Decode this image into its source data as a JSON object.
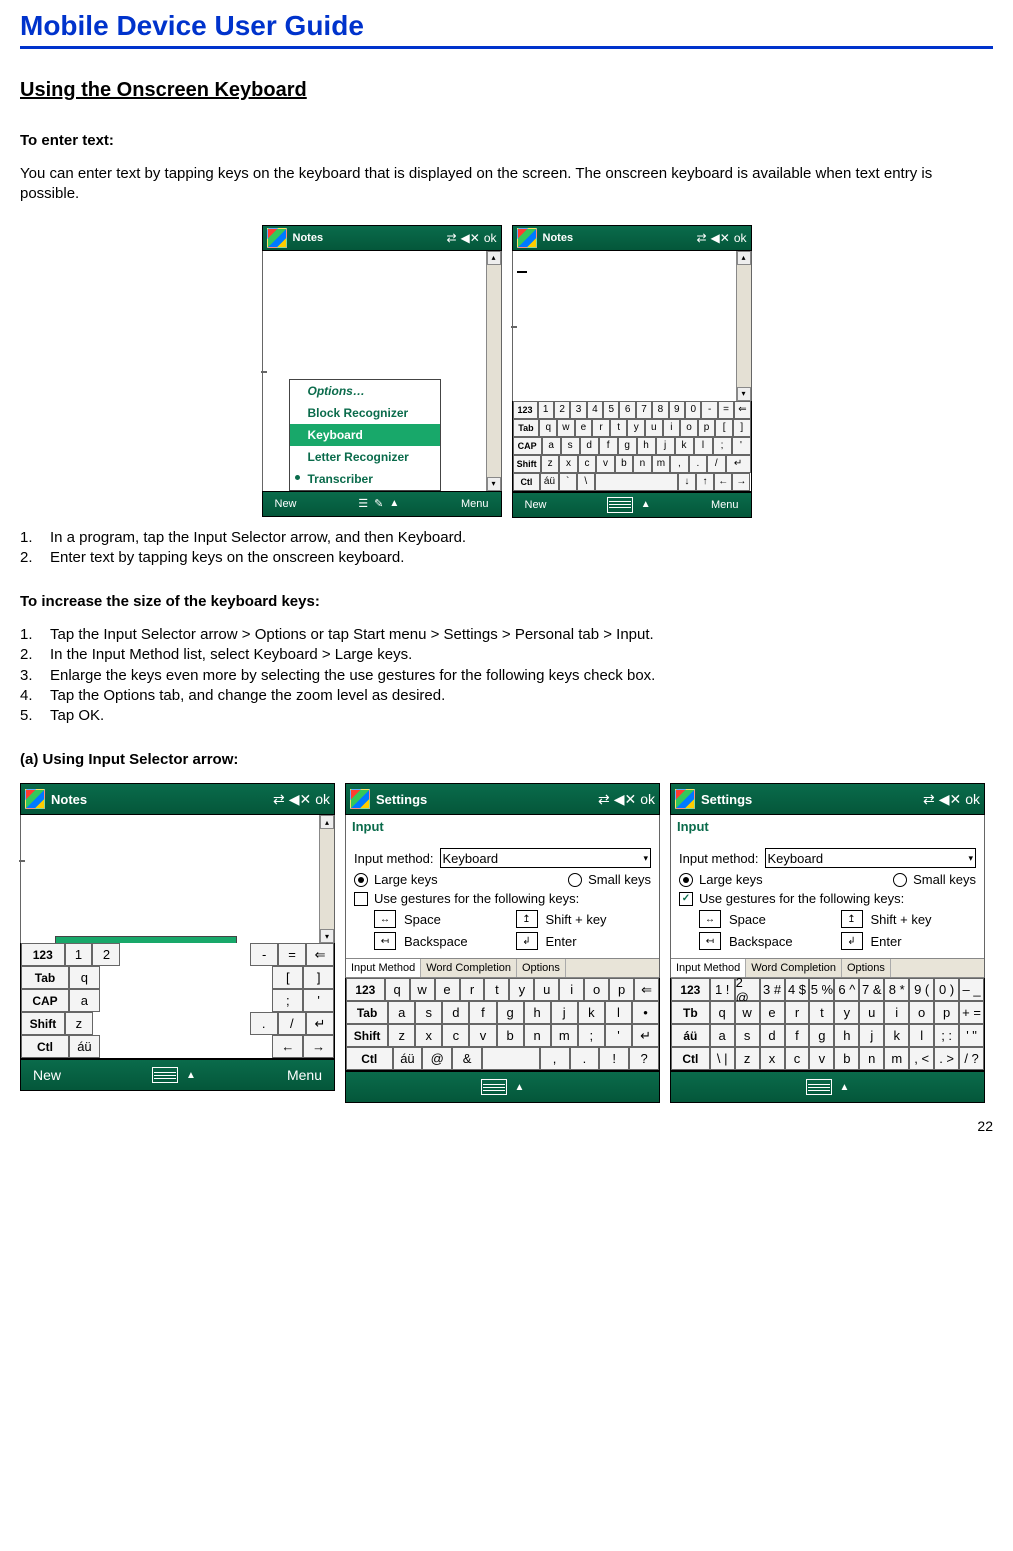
{
  "doc": {
    "title": "Mobile Device User Guide",
    "page_number": "22",
    "section_heading": "Using the Onscreen Keyboard",
    "enter_heading": "To enter text:",
    "enter_body": "You can enter text by tapping keys on the keyboard that is displayed on the screen. The onscreen keyboard is available when text entry is possible.",
    "enter_steps": [
      "In a program, tap the Input Selector arrow, and then Keyboard.",
      "Enter text by tapping keys on the onscreen keyboard."
    ],
    "enlarge_heading": "To increase the size of the keyboard keys:",
    "enlarge_steps": [
      "Tap the Input Selector arrow > Options or tap Start menu > Settings > Personal tab > Input.",
      "In the Input Method list, select Keyboard > Large keys.",
      "Enlarge the keys even more by selecting the use gestures for the following keys check box.",
      "Tap the Options tab, and change the zoom level as desired.",
      "Tap OK."
    ],
    "subsection_a": "(a)   Using Input Selector arrow:"
  },
  "common": {
    "ok": "ok",
    "new": "New",
    "menu": "Menu",
    "signal_glyph": "⇄",
    "volume_glyph": "◀✕"
  },
  "apps": {
    "notes": "Notes",
    "settings": "Settings",
    "input_section": "Input"
  },
  "im_popup": {
    "options": "Options…",
    "block": "Block Recognizer",
    "keyboard": "Keyboard",
    "letter": "Letter Recognizer",
    "transcriber": "Transcriber"
  },
  "settings_form": {
    "input_method_label": "Input method:",
    "input_method_value": "Keyboard",
    "large_keys": "Large keys",
    "small_keys": "Small keys",
    "use_gestures": "Use gestures for the following keys:",
    "space": "Space",
    "shift_key": "Shift + key",
    "backspace": "Backspace",
    "enter": "Enter",
    "tab_input_method": "Input Method",
    "tab_word_completion": "Word Completion",
    "tab_options": "Options"
  },
  "kbd_small": {
    "row0_lbl": "123",
    "row0": [
      "1",
      "2",
      "3",
      "4",
      "5",
      "6",
      "7",
      "8",
      "9",
      "0",
      "-",
      "="
    ],
    "row1_lbl": "Tab",
    "row1": [
      "q",
      "w",
      "e",
      "r",
      "t",
      "y",
      "u",
      "i",
      "o",
      "p",
      "[",
      "]"
    ],
    "row2_lbl": "CAP",
    "row2": [
      "a",
      "s",
      "d",
      "f",
      "g",
      "h",
      "j",
      "k",
      "l",
      ";",
      "'"
    ],
    "row3_lbl": "Shift",
    "row3": [
      "z",
      "x",
      "c",
      "v",
      "b",
      "n",
      "m",
      ",",
      ".",
      "/"
    ],
    "row4_lbl": "Ctl",
    "row4_a": "áü",
    "row4_b": "`",
    "row4_c": "\\",
    "arrows": [
      "↓",
      "↑",
      "←",
      "→"
    ]
  },
  "kbd_large_a": {
    "row0_lbl": "123",
    "row0": [
      "q",
      "w",
      "e",
      "r",
      "t",
      "y",
      "u",
      "i",
      "o",
      "p"
    ],
    "row0_end": "⇐",
    "row1_lbl": "Tab",
    "row1": [
      "a",
      "s",
      "d",
      "f",
      "g",
      "h",
      "j",
      "k",
      "l",
      "•"
    ],
    "row2_lbl": "Shift",
    "row2": [
      "z",
      "x",
      "c",
      "v",
      "b",
      "n",
      "m",
      ";",
      "'"
    ],
    "row2_end": "↵",
    "row3_lbl": "Ctl",
    "row3": [
      "áü",
      "@",
      "&",
      " ",
      ",",
      ".",
      "!",
      "?"
    ]
  },
  "kbd_large_b": {
    "row0_lbl": "123",
    "row0_pairs": [
      "1 !",
      "2 @",
      "3 #",
      "4 $",
      "5 %",
      "6 ^",
      "7 &",
      "8 *",
      "9 (",
      "0 )"
    ],
    "row0_end": "– _",
    "row1_lbl": "Tb",
    "row1": [
      "q",
      "w",
      "e",
      "r",
      "t",
      "y",
      "u",
      "i",
      "o",
      "p"
    ],
    "row1_end": "+ =",
    "row2_lbl": "áü",
    "row2": [
      "a",
      "s",
      "d",
      "f",
      "g",
      "h",
      "j",
      "k",
      "l"
    ],
    "row2_end1": "; :",
    "row2_end2": "' \"",
    "row3_lbl": "Ctl",
    "row3_a": "\\ |",
    "row3": [
      "z",
      "x",
      "c",
      "v",
      "b",
      "n",
      "m"
    ],
    "row3_end1": ", <",
    "row3_end2": ". >",
    "row3_end3": "/ ?"
  },
  "kbd_notes_trunc": {
    "row0_lbl": "123",
    "row0": [
      "1",
      "2"
    ],
    "row0_r": [
      "-",
      "="
    ],
    "row1_lbl": "Tab",
    "row1": [
      "q"
    ],
    "row1_r": [
      "[",
      "]"
    ],
    "row2_lbl": "CAP",
    "row2": [
      "a"
    ],
    "row2_r": [
      ";",
      "'"
    ],
    "row3_lbl": "Shift",
    "row3": [
      "z"
    ],
    "row3_r": [
      ".",
      "/"
    ],
    "row4_lbl": "Ctl",
    "row4_a": "áü",
    "row4_r": [
      "←",
      "→"
    ]
  }
}
